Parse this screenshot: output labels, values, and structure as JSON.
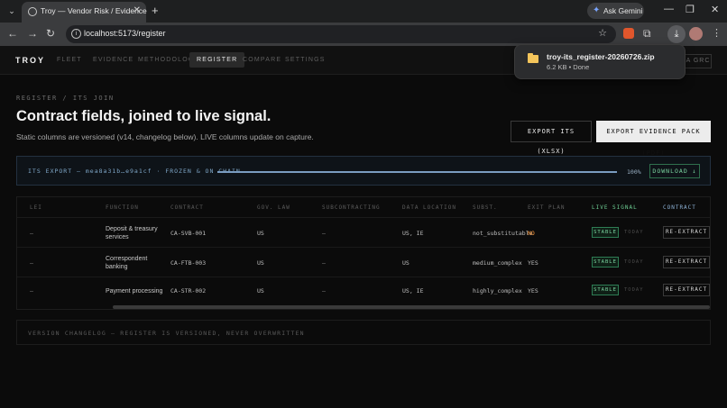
{
  "browser": {
    "tab_title": "Troy — Vendor Risk / Evidence",
    "url": "localhost:5173/register",
    "gemini_label": "Ask Gemini"
  },
  "download": {
    "filename": "troy-its_register-20260726.zip",
    "meta": "6.2 KB • Done"
  },
  "app": {
    "logo": "TROY",
    "nav": [
      "FLEET",
      "EVIDENCE",
      "METHODOLOGY",
      "REGISTER",
      "COMPARE",
      "SETTINGS"
    ],
    "nav_active": "REGISTER",
    "nav_right": "RA GRC"
  },
  "page": {
    "breadcrumb": "REGISTER / ITS JOIN",
    "title": "Contract fields, joined to live signal.",
    "subtitle": "Static columns are versioned (v14, changelog below). LIVE columns update on capture.",
    "btn_export_its": "EXPORT ITS (XLSX)",
    "btn_export_pack": "EXPORT EVIDENCE PACK (PDF)"
  },
  "export": {
    "label": "ITS EXPORT — mea8a31b…e9a1cf · FROZEN & ON CHAIN",
    "progress": 100,
    "percent_label": "100%",
    "download_label": "DOWNLOAD ↓"
  },
  "table": {
    "headers": [
      "LEI",
      "FUNCTION",
      "CONTRACT",
      "GOV. LAW",
      "SUBCONTRACTING",
      "DATA LOCATION",
      "SUBST.",
      "EXIT PLAN",
      "LIVE SIGNAL",
      "CONTRACT"
    ],
    "rows": [
      {
        "lei": "—",
        "function": "Deposit & treasury services",
        "contract": "CA-SVB-001",
        "gov_law": "US",
        "subcontracting": "—",
        "data_location": "US, IE",
        "subst": "not_substitutable",
        "exit_plan": "NO",
        "signal": "STABLE",
        "signal_time": "TODAY",
        "action": "RE-EXTRACT"
      },
      {
        "lei": "—",
        "function": "Correspondent banking",
        "contract": "CA-FTB-003",
        "gov_law": "US",
        "subcontracting": "—",
        "data_location": "US",
        "subst": "medium_complex",
        "exit_plan": "YES",
        "signal": "STABLE",
        "signal_time": "TODAY",
        "action": "RE-EXTRACT"
      },
      {
        "lei": "—",
        "function": "Payment processing",
        "contract": "CA-STR-002",
        "gov_law": "US",
        "subcontracting": "—",
        "data_location": "US, IE",
        "subst": "highly_complex",
        "exit_plan": "YES",
        "signal": "STABLE",
        "signal_time": "TODAY",
        "action": "RE-EXTRACT"
      }
    ]
  },
  "changelog": {
    "label": "VERSION CHANGELOG — REGISTER IS VERSIONED, NEVER OVERWRITTEN"
  },
  "colors": {
    "accent_green": "#7bd5a0",
    "accent_orange": "#ff9a3c",
    "accent_blue": "#8fb4d8"
  }
}
